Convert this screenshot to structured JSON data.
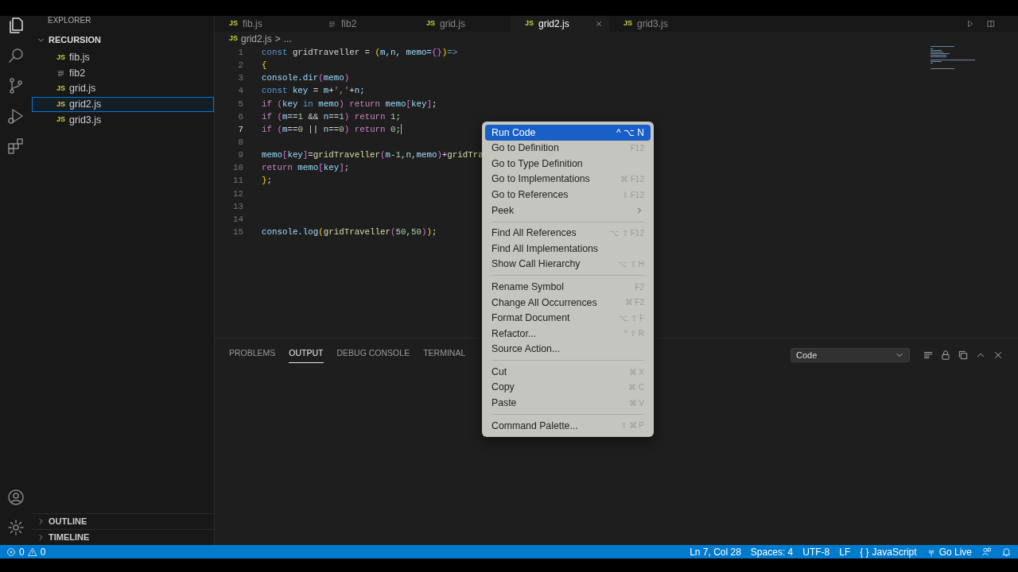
{
  "sidebar": {
    "title": "EXPLORER",
    "folder": {
      "label": "RECURSION",
      "expanded": true
    },
    "files": [
      {
        "label": "fib.js",
        "kind": "js",
        "icon": "JS",
        "selected": false
      },
      {
        "label": "fib2",
        "kind": "text",
        "selected": false
      },
      {
        "label": "grid.js",
        "kind": "js",
        "icon": "JS",
        "selected": false
      },
      {
        "label": "grid2.js",
        "kind": "js",
        "icon": "JS",
        "selected": true
      },
      {
        "label": "grid3.js",
        "kind": "js",
        "icon": "JS",
        "selected": false
      }
    ],
    "sections": [
      {
        "label": "OUTLINE",
        "expanded": false
      },
      {
        "label": "TIMELINE",
        "expanded": false
      }
    ]
  },
  "tabs": [
    {
      "label": "fib.js",
      "kind": "js",
      "icon": "JS",
      "selected": false
    },
    {
      "label": "fib2",
      "kind": "text",
      "selected": false
    },
    {
      "label": "grid.js",
      "kind": "js",
      "icon": "JS",
      "selected": false
    },
    {
      "label": "grid2.js",
      "kind": "js",
      "icon": "JS",
      "selected": true
    },
    {
      "label": "grid3.js",
      "kind": "js",
      "icon": "JS",
      "selected": false
    }
  ],
  "breadcrumb": {
    "icon": "JS",
    "file": "grid2.js",
    "separator": ">",
    "tail": "..."
  },
  "code": [
    {
      "number": "1",
      "active": false,
      "tokens": [
        {
          "text": "const",
          "kind": "kw"
        },
        {
          "text": " gridTraveller = ",
          "kind": "plain"
        },
        {
          "text": "(",
          "kind": "b1"
        },
        {
          "text": "m,n, memo=",
          "kind": "var"
        },
        {
          "text": "{}",
          "kind": "b2"
        },
        {
          "text": ")",
          "kind": "b1"
        },
        {
          "text": "=>",
          "kind": "kw"
        }
      ]
    },
    {
      "number": "2",
      "active": false,
      "tokens": [
        {
          "text": "{",
          "kind": "b1"
        }
      ]
    },
    {
      "number": "3",
      "active": false,
      "tokens": [
        {
          "text": "console.dir",
          "kind": "var"
        },
        {
          "text": "(",
          "kind": "b2"
        },
        {
          "text": "memo",
          "kind": "var"
        },
        {
          "text": ")",
          "kind": "b2"
        }
      ]
    },
    {
      "number": "4",
      "active": false,
      "tokens": [
        {
          "text": "const",
          "kind": "kw"
        },
        {
          "text": " key",
          "kind": "var"
        },
        {
          "text": " = ",
          "kind": "plain"
        },
        {
          "text": "m",
          "kind": "var"
        },
        {
          "text": "+",
          "kind": "plain"
        },
        {
          "text": "','",
          "kind": "str"
        },
        {
          "text": "+",
          "kind": "plain"
        },
        {
          "text": "n",
          "kind": "var"
        },
        {
          "text": ";",
          "kind": "plain"
        }
      ]
    },
    {
      "number": "5",
      "active": false,
      "tokens": [
        {
          "text": "if ",
          "kind": "ctl"
        },
        {
          "text": "(",
          "kind": "b2"
        },
        {
          "text": "key",
          "kind": "var"
        },
        {
          "text": " in ",
          "kind": "kw"
        },
        {
          "text": "memo",
          "kind": "var"
        },
        {
          "text": ")",
          "kind": "b2"
        },
        {
          "text": " return ",
          "kind": "ctl"
        },
        {
          "text": "memo",
          "kind": "var"
        },
        {
          "text": "[",
          "kind": "b2"
        },
        {
          "text": "key",
          "kind": "var"
        },
        {
          "text": "]",
          "kind": "b2"
        },
        {
          "text": ";",
          "kind": "plain"
        }
      ]
    },
    {
      "number": "6",
      "active": false,
      "tokens": [
        {
          "text": "if ",
          "kind": "ctl"
        },
        {
          "text": "(",
          "kind": "b2"
        },
        {
          "text": "m",
          "kind": "var"
        },
        {
          "text": "==",
          "kind": "plain"
        },
        {
          "text": "1",
          "kind": "num"
        },
        {
          "text": " && ",
          "kind": "plain"
        },
        {
          "text": "n",
          "kind": "var"
        },
        {
          "text": "==",
          "kind": "plain"
        },
        {
          "text": "1",
          "kind": "num"
        },
        {
          "text": ")",
          "kind": "b2"
        },
        {
          "text": " return ",
          "kind": "ctl"
        },
        {
          "text": "1",
          "kind": "num"
        },
        {
          "text": ";",
          "kind": "plain"
        }
      ]
    },
    {
      "number": "7",
      "active": true,
      "tokens": [
        {
          "text": "if ",
          "kind": "ctl"
        },
        {
          "text": "(",
          "kind": "b2"
        },
        {
          "text": "m",
          "kind": "var"
        },
        {
          "text": "==",
          "kind": "plain"
        },
        {
          "text": "0",
          "kind": "num"
        },
        {
          "text": " || ",
          "kind": "plain"
        },
        {
          "text": "n",
          "kind": "var"
        },
        {
          "text": "==",
          "kind": "plain"
        },
        {
          "text": "0",
          "kind": "num"
        },
        {
          "text": ")",
          "kind": "b2"
        },
        {
          "text": " return ",
          "kind": "ctl"
        },
        {
          "text": "0",
          "kind": "num"
        },
        {
          "text": ";",
          "kind": "plain"
        }
      ]
    },
    {
      "number": "8",
      "active": false
    },
    {
      "number": "9",
      "active": false,
      "tokens": [
        {
          "text": "memo",
          "kind": "var"
        },
        {
          "text": "[",
          "kind": "b2"
        },
        {
          "text": "key",
          "kind": "var"
        },
        {
          "text": "]",
          "kind": "b2"
        },
        {
          "text": "=",
          "kind": "plain"
        },
        {
          "text": "gridTraveller",
          "kind": "fn"
        },
        {
          "text": "(",
          "kind": "b2"
        },
        {
          "text": "m",
          "kind": "var"
        },
        {
          "text": "-",
          "kind": "plain"
        },
        {
          "text": "1",
          "kind": "num"
        },
        {
          "text": ",",
          "kind": "plain"
        },
        {
          "text": "n",
          "kind": "var"
        },
        {
          "text": ",",
          "kind": "plain"
        },
        {
          "text": "memo",
          "kind": "var"
        },
        {
          "text": ")",
          "kind": "b2"
        },
        {
          "text": "+",
          "kind": "plain"
        },
        {
          "text": "gridTra",
          "kind": "fn"
        }
      ]
    },
    {
      "number": "10",
      "active": false,
      "tokens": [
        {
          "text": "return ",
          "kind": "ctl"
        },
        {
          "text": "memo",
          "kind": "var"
        },
        {
          "text": "[",
          "kind": "b2"
        },
        {
          "text": "key",
          "kind": "var"
        },
        {
          "text": "]",
          "kind": "b2"
        },
        {
          "text": ";",
          "kind": "plain"
        }
      ]
    },
    {
      "number": "11",
      "active": false,
      "tokens": [
        {
          "text": "}",
          "kind": "b1"
        },
        {
          "text": ";",
          "kind": "plain"
        }
      ]
    },
    {
      "number": "12",
      "active": false
    },
    {
      "number": "13",
      "active": false
    },
    {
      "number": "14",
      "active": false
    },
    {
      "number": "15",
      "active": false,
      "tokens": [
        {
          "text": "console.log",
          "kind": "var"
        },
        {
          "text": "(",
          "kind": "b1"
        },
        {
          "text": "gridTraveller",
          "kind": "fn"
        },
        {
          "text": "(",
          "kind": "b2"
        },
        {
          "text": "50",
          "kind": "num"
        },
        {
          "text": ",",
          "kind": "plain"
        },
        {
          "text": "50",
          "kind": "num"
        },
        {
          "text": ")",
          "kind": "b2"
        },
        {
          "text": ")",
          "kind": "b1"
        },
        {
          "text": ";",
          "kind": "plain"
        }
      ]
    }
  ],
  "context_menu": {
    "sections": [
      {
        "items": [
          {
            "label": "Run Code",
            "shortcut": "^ ⌥ N",
            "selected": true
          },
          {
            "label": "Go to Definition",
            "shortcut": "F12",
            "selected": false
          },
          {
            "label": "Go to Type Definition",
            "selected": false
          },
          {
            "label": "Go to Implementations",
            "shortcut": "⌘ F12",
            "selected": false
          },
          {
            "label": "Go to References",
            "shortcut": "⇧ F12",
            "selected": false
          },
          {
            "label": "Peek",
            "submenu": true,
            "selected": false
          }
        ]
      },
      {
        "items": [
          {
            "label": "Find All References",
            "shortcut": "⌥ ⇧ F12",
            "selected": false
          },
          {
            "label": "Find All Implementations",
            "selected": false
          },
          {
            "label": "Show Call Hierarchy",
            "shortcut": "⌥ ⇧ H",
            "selected": false
          }
        ]
      },
      {
        "items": [
          {
            "label": "Rename Symbol",
            "shortcut": "F2",
            "selected": false
          },
          {
            "label": "Change All Occurrences",
            "shortcut": "⌘ F2",
            "selected": false
          },
          {
            "label": "Format Document",
            "shortcut": "⌥ ⇧ F",
            "selected": false
          },
          {
            "label": "Refactor...",
            "shortcut": "^ ⇧ R",
            "selected": false
          },
          {
            "label": "Source Action...",
            "selected": false
          }
        ]
      },
      {
        "items": [
          {
            "label": "Cut",
            "shortcut": "⌘ X",
            "selected": false
          },
          {
            "label": "Copy",
            "shortcut": "⌘ C",
            "selected": false
          },
          {
            "label": "Paste",
            "shortcut": "⌘ V",
            "selected": false
          }
        ]
      },
      {
        "items": [
          {
            "label": "Command Palette...",
            "shortcut": "⇧ ⌘ P",
            "selected": false
          }
        ]
      }
    ]
  },
  "panel": {
    "tabs": [
      {
        "label": "PROBLEMS",
        "selected": false
      },
      {
        "label": "OUTPUT",
        "selected": true
      },
      {
        "label": "DEBUG CONSOLE",
        "selected": false
      },
      {
        "label": "TERMINAL",
        "selected": false
      }
    ],
    "channel": "Code"
  },
  "status_bar": {
    "errors": "0",
    "warnings": "0",
    "position": "Ln 7, Col 28",
    "indent": "Spaces: 4",
    "encoding": "UTF-8",
    "eol": "LF",
    "language_icon": "{ }",
    "language": "JavaScript",
    "live": "Go Live"
  }
}
